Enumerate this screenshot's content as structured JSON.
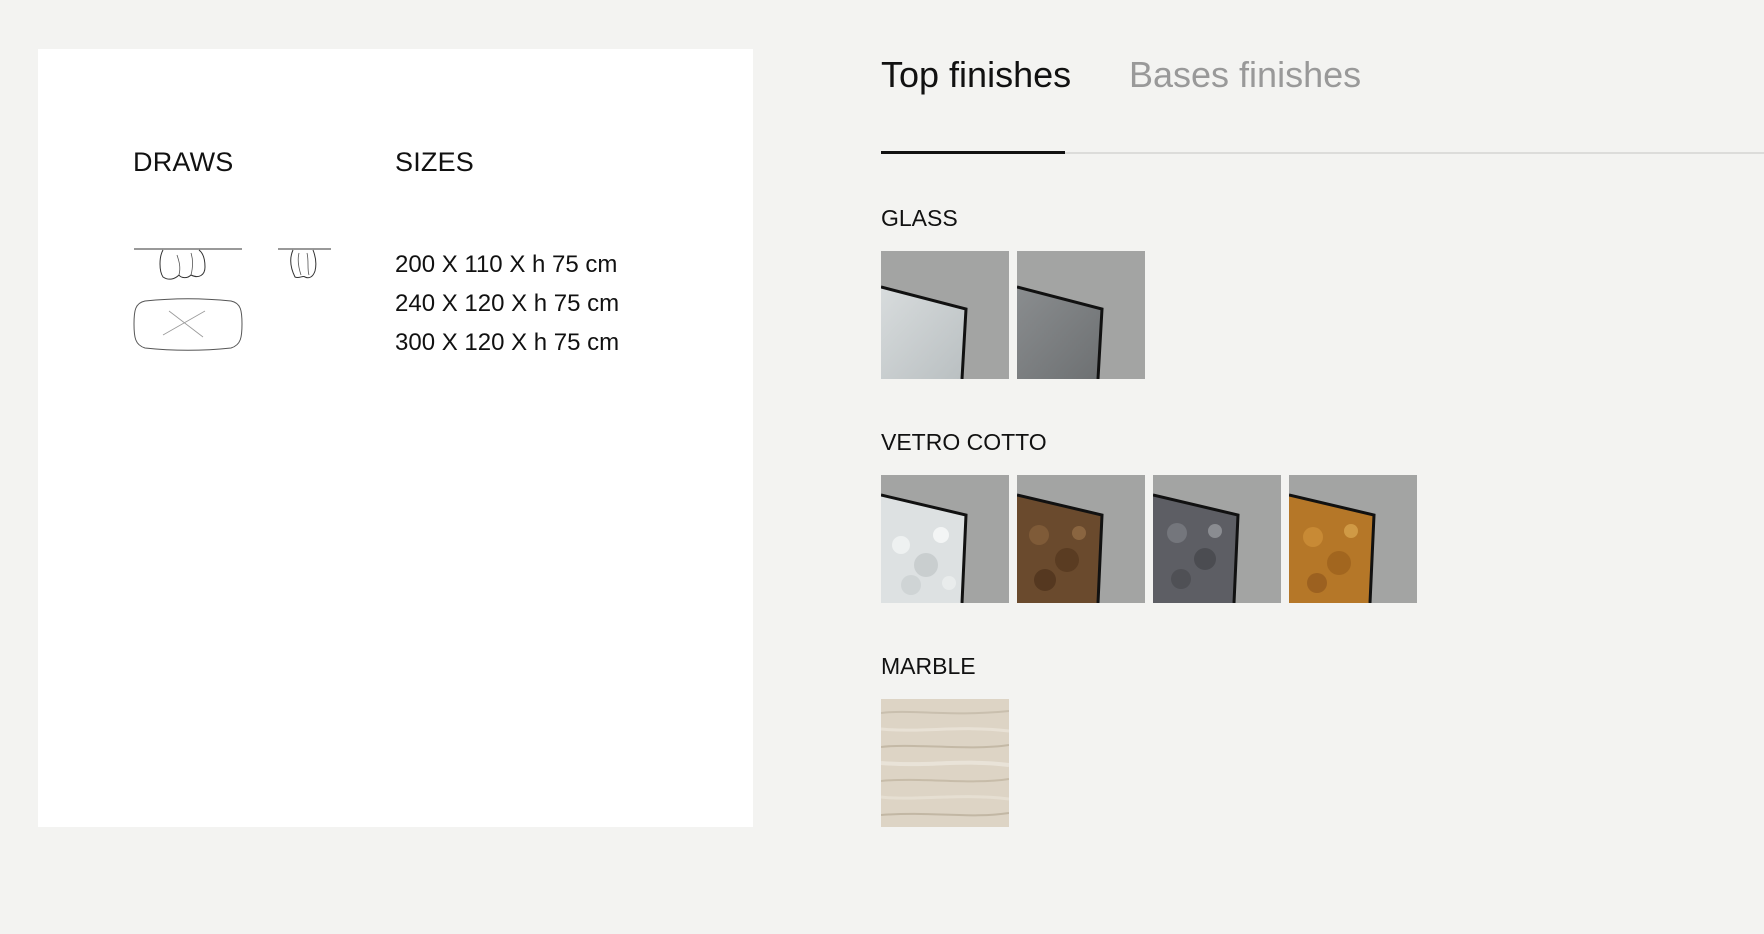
{
  "left_card": {
    "draws_heading": "DRAWS",
    "sizes_heading": "SIZES",
    "sizes": [
      "200 X 110 X h 75 cm",
      "240 X 120 X h 75 cm",
      "300 X 120 X h 75 cm"
    ]
  },
  "tabs": [
    {
      "label": "Top finishes",
      "active": true
    },
    {
      "label": "Bases finishes",
      "active": false
    }
  ],
  "sections": [
    {
      "label": "GLASS",
      "swatches": [
        {
          "name": "glass-clear",
          "color": "#c9cecf"
        },
        {
          "name": "glass-smoked",
          "color": "#7b7e80"
        }
      ]
    },
    {
      "label": "VETRO COTTO",
      "swatches": [
        {
          "name": "vetro-cotto-white",
          "color": "#dfe3e3"
        },
        {
          "name": "vetro-cotto-bronze",
          "color": "#6b4a2c"
        },
        {
          "name": "vetro-cotto-grey",
          "color": "#5c5d62"
        },
        {
          "name": "vetro-cotto-amber",
          "color": "#b87a2a"
        }
      ]
    },
    {
      "label": "MARBLE",
      "swatches": [
        {
          "name": "marble-travertine",
          "color": "#ddd4c5"
        }
      ]
    }
  ],
  "colors": {
    "background": "#f3f3f1",
    "card": "#ffffff",
    "swatch_backdrop": "#a3a4a3",
    "inactive_tab": "#999999"
  }
}
